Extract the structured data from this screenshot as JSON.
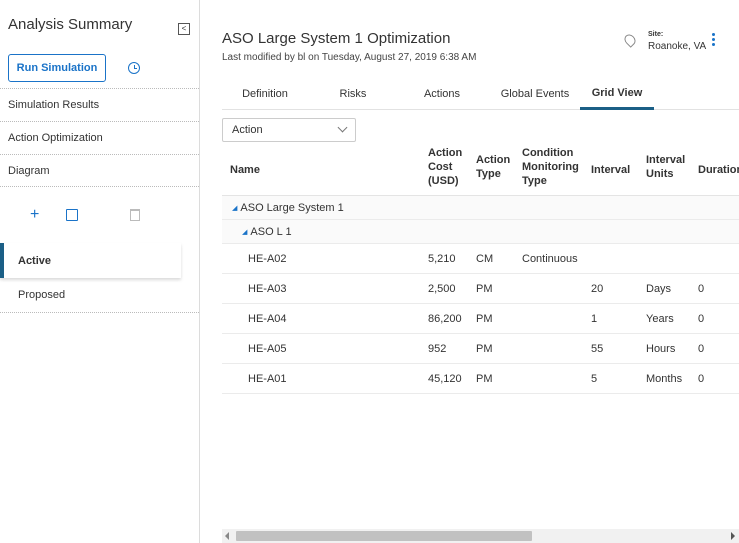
{
  "sidebar": {
    "title": "Analysis Summary",
    "collapse_glyph": "<",
    "run_button": "Run Simulation",
    "menu": [
      {
        "label": "Simulation Results"
      },
      {
        "label": "Action Optimization"
      },
      {
        "label": "Diagram"
      }
    ],
    "tools": {
      "add_glyph": "+"
    },
    "scenarios": [
      {
        "label": "Active",
        "active": true
      },
      {
        "label": "Proposed",
        "active": false
      }
    ]
  },
  "header": {
    "title": "ASO Large System 1 Optimization",
    "subtitle": "Last modified by bl on Tuesday, August 27, 2019 6:38 AM",
    "site_label": "Site:",
    "site_value": "Roanoke, VA"
  },
  "tabs": [
    {
      "label": "Definition"
    },
    {
      "label": "Risks"
    },
    {
      "label": "Actions"
    },
    {
      "label": "Global Events"
    },
    {
      "label": "Grid View",
      "selected": true
    }
  ],
  "filter": {
    "value": "Action"
  },
  "grid": {
    "columns": {
      "name": "Name",
      "cost": [
        "Action",
        "Cost",
        "(USD)"
      ],
      "type": [
        "Action",
        "Type"
      ],
      "cm": [
        "Condition",
        "Monitoring",
        "Type"
      ],
      "interval": "Interval",
      "units": [
        "Interval",
        "Units"
      ],
      "duration": "Duration"
    },
    "groups": [
      {
        "label": "ASO Large System 1"
      },
      {
        "label": "ASO L 1"
      }
    ],
    "rows": [
      {
        "name": "HE-A02",
        "cost": "5,210",
        "type": "CM",
        "cm": "Continuous",
        "interval": "",
        "units": "",
        "duration": ""
      },
      {
        "name": "HE-A03",
        "cost": "2,500",
        "type": "PM",
        "cm": "",
        "interval": "20",
        "units": "Days",
        "duration": "0"
      },
      {
        "name": "HE-A04",
        "cost": "86,200",
        "type": "PM",
        "cm": "",
        "interval": "1",
        "units": "Years",
        "duration": "0"
      },
      {
        "name": "HE-A05",
        "cost": "952",
        "type": "PM",
        "cm": "",
        "interval": "55",
        "units": "Hours",
        "duration": "0"
      },
      {
        "name": "HE-A01",
        "cost": "45,120",
        "type": "PM",
        "cm": "",
        "interval": "5",
        "units": "Months",
        "duration": "0"
      }
    ]
  },
  "colors": {
    "accent": "#1a73c8",
    "selected_tab": "#1b5f86"
  }
}
